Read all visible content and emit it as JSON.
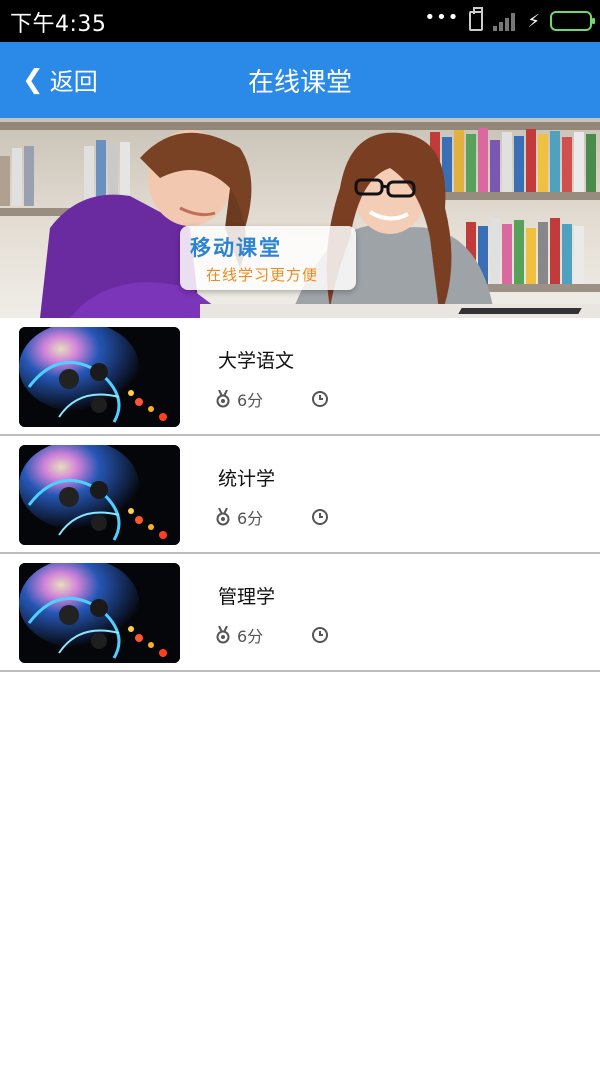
{
  "status_bar": {
    "time": "下午4:35",
    "icons": [
      "more-dots-icon",
      "sim-card-icon",
      "signal-icon",
      "charging-icon",
      "battery-icon"
    ],
    "battery_color": "#6fd86f"
  },
  "header": {
    "back_label": "返回",
    "title": "在线课堂",
    "background": "#2b89e8"
  },
  "banner": {
    "headline": "移动课堂",
    "subline": "在线学习更方便"
  },
  "courses": [
    {
      "name": "大学语文",
      "score": "6分"
    },
    {
      "name": "统计学",
      "score": "6分"
    },
    {
      "name": "管理学",
      "score": "6分"
    }
  ]
}
